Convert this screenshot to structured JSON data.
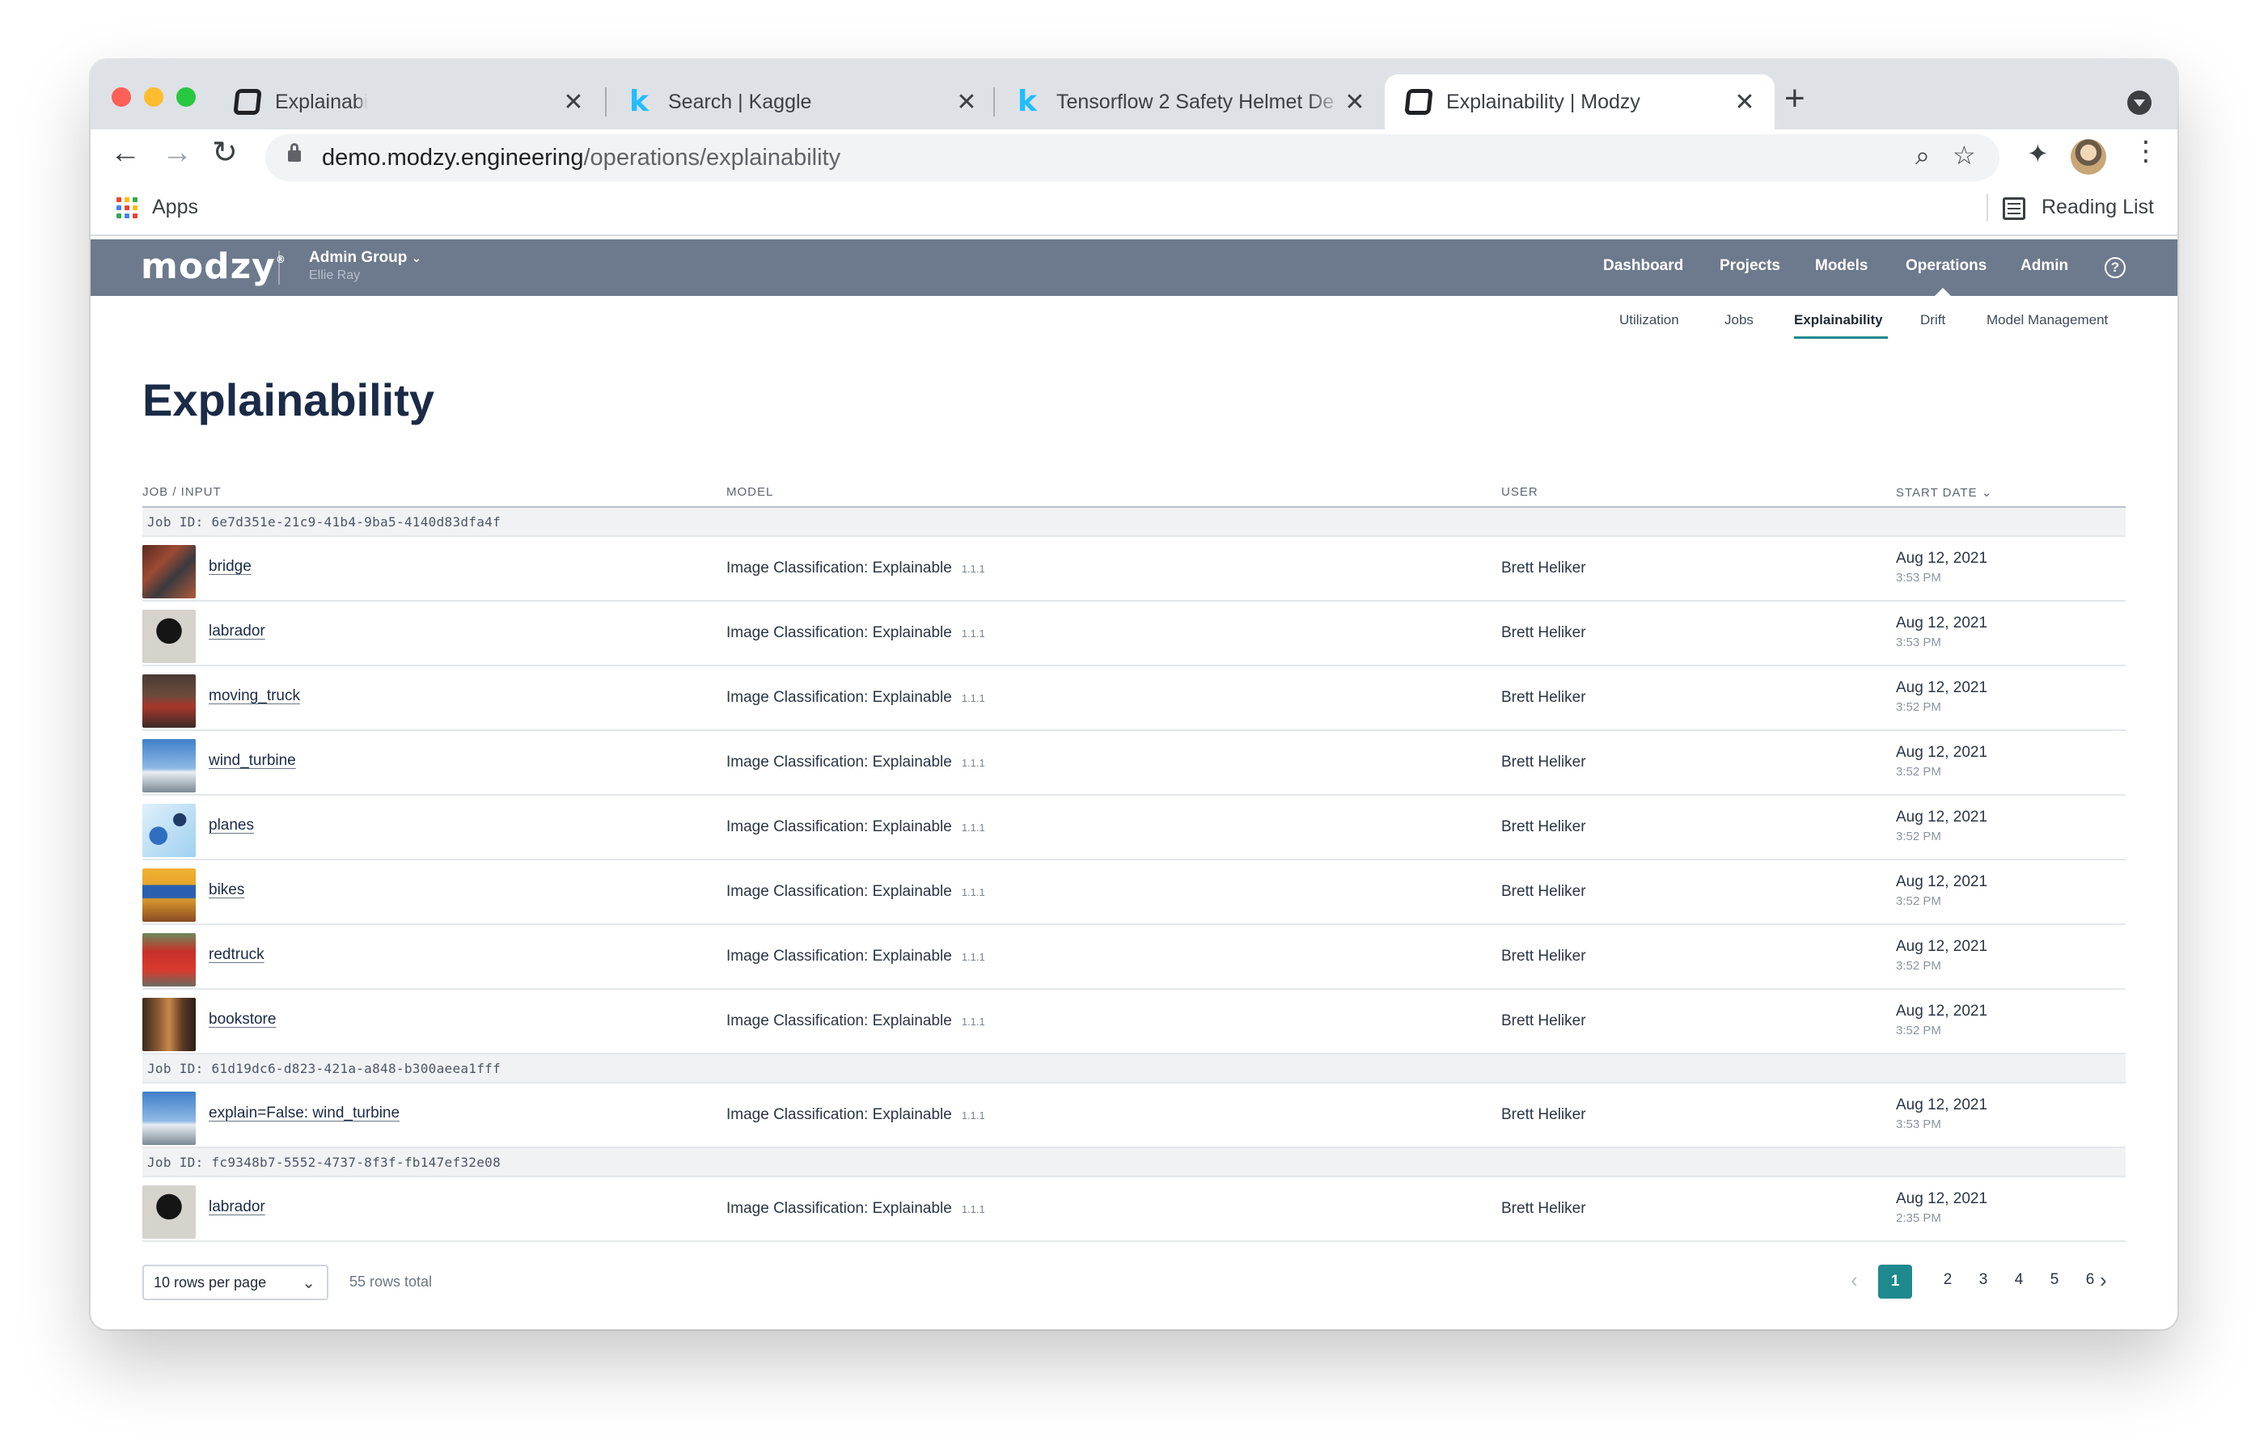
{
  "browser": {
    "tabs": [
      {
        "title": "Explainability | Documentation",
        "icon": "modzy-favicon-icon"
      },
      {
        "title": "Search | Kaggle",
        "icon": "kaggle-favicon-icon"
      },
      {
        "title": "Tensorflow 2 Safety Helmet De",
        "icon": "kaggle-favicon-icon"
      },
      {
        "title": "Explainability | Modzy",
        "icon": "modzy-favicon-icon",
        "active": true
      }
    ],
    "close_glyph": "✕",
    "kaggle_glyph": "k",
    "new_tab_glyph": "+",
    "url_host": "demo.modzy.engineering",
    "url_path": "/operations/explainability",
    "bookmarks": {
      "apps_label": "Apps",
      "reading_list_label": "Reading List"
    }
  },
  "app": {
    "logo": "modzy",
    "logo_mark": "®",
    "group_name": "Admin Group",
    "group_user": "Ellie Ray",
    "nav": [
      "Dashboard",
      "Projects",
      "Models",
      "Operations",
      "Admin"
    ],
    "active_nav": "Operations",
    "help_glyph": "?",
    "subnav": [
      "Utilization",
      "Jobs",
      "Explainability",
      "Drift",
      "Model Management"
    ],
    "active_subnav": "Explainability",
    "accent": "#1e8a8e",
    "header_bg": "#6d7a8d"
  },
  "page": {
    "title": "Explainability",
    "columns": {
      "job_input": "JOB / INPUT",
      "model": "MODEL",
      "user": "USER",
      "start_date": "START DATE"
    },
    "sort_glyph": "⌄",
    "groups": [
      {
        "job_id": "Job ID: 6e7d351e-21c9-41b4-9ba5-4140d83dfa4f",
        "rows": [
          {
            "input": "bridge",
            "model": "Image Classification: Explainable",
            "version": "1.1.1",
            "user": "Brett Heliker",
            "date": "Aug 12, 2021",
            "time": "3:53 PM"
          },
          {
            "input": "labrador",
            "model": "Image Classification: Explainable",
            "version": "1.1.1",
            "user": "Brett Heliker",
            "date": "Aug 12, 2021",
            "time": "3:53 PM"
          },
          {
            "input": "moving_truck",
            "model": "Image Classification: Explainable",
            "version": "1.1.1",
            "user": "Brett Heliker",
            "date": "Aug 12, 2021",
            "time": "3:52 PM"
          },
          {
            "input": "wind_turbine",
            "model": "Image Classification: Explainable",
            "version": "1.1.1",
            "user": "Brett Heliker",
            "date": "Aug 12, 2021",
            "time": "3:52 PM"
          },
          {
            "input": "planes",
            "model": "Image Classification: Explainable",
            "version": "1.1.1",
            "user": "Brett Heliker",
            "date": "Aug 12, 2021",
            "time": "3:52 PM"
          },
          {
            "input": "bikes",
            "model": "Image Classification: Explainable",
            "version": "1.1.1",
            "user": "Brett Heliker",
            "date": "Aug 12, 2021",
            "time": "3:52 PM"
          },
          {
            "input": "redtruck",
            "model": "Image Classification: Explainable",
            "version": "1.1.1",
            "user": "Brett Heliker",
            "date": "Aug 12, 2021",
            "time": "3:52 PM"
          },
          {
            "input": "bookstore",
            "model": "Image Classification: Explainable",
            "version": "1.1.1",
            "user": "Brett Heliker",
            "date": "Aug 12, 2021",
            "time": "3:52 PM"
          }
        ]
      },
      {
        "job_id": "Job ID: 61d19dc6-d823-421a-a848-b300aeea1fff",
        "rows": [
          {
            "input": "explain=False: wind_turbine",
            "model": "Image Classification: Explainable",
            "version": "1.1.1",
            "user": "Brett Heliker",
            "date": "Aug 12, 2021",
            "time": "3:53 PM"
          }
        ]
      },
      {
        "job_id": "Job ID: fc9348b7-5552-4737-8f3f-fb147ef32e08",
        "rows": [
          {
            "input": "labrador",
            "model": "Image Classification: Explainable",
            "version": "1.1.1",
            "user": "Brett Heliker",
            "date": "Aug 12, 2021",
            "time": "2:35 PM"
          }
        ]
      }
    ],
    "footer": {
      "rows_per_page": "10 rows per page",
      "rows_total": "55 rows total",
      "pages": [
        "1",
        "2",
        "3",
        "4",
        "5",
        "6"
      ],
      "current_page": "1",
      "prev_glyph": "‹",
      "next_glyph": "›"
    }
  }
}
